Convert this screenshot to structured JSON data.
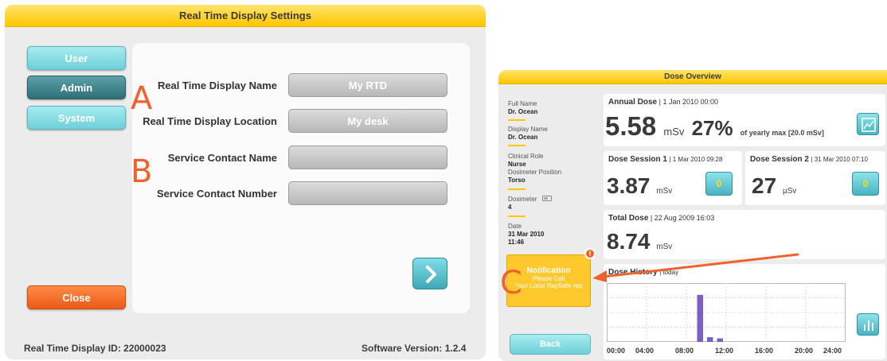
{
  "settings": {
    "title": "Real Time Display Settings",
    "sidebar": {
      "user": "User",
      "admin": "Admin",
      "system": "System",
      "close": "Close"
    },
    "fields": [
      {
        "label": "Real Time Display Name",
        "value": "My RTD"
      },
      {
        "label": "Real Time Display Location",
        "value": "My desk"
      },
      {
        "label": "Service Contact Name",
        "value": ""
      },
      {
        "label": "Service Contact Number",
        "value": ""
      }
    ],
    "footer": {
      "id": "Real Time Display ID: 22000023",
      "version": "Software Version: 1.2.4"
    }
  },
  "annotations": {
    "a": "A",
    "b": "B",
    "c": "C",
    "color": "#f0622d"
  },
  "dose": {
    "title": "Dose Overview",
    "info": {
      "full_name_label": "Full Name",
      "full_name": "Dr. Ocean",
      "display_name_label": "Display Name",
      "display_name": "Dr. Ocean",
      "clinical_role_label": "Clinical Role",
      "clinical_role": "Nurse",
      "position_label": "Dosimeter Position",
      "position": "Torso",
      "dosimeter_label": "Dosimeter",
      "dosimeter": "4",
      "date_label": "Date",
      "date": "31 Mar 2010",
      "time": "11:46"
    },
    "annual": {
      "title": "Annual Dose",
      "date": "| 1 Jan 2010 00:00",
      "value": "5.58",
      "unit": "mSv",
      "percent": "27%",
      "of_max": "of yearly max [20.0 mSv]"
    },
    "session1": {
      "title": "Dose Session 1",
      "date": "| 1 Mar 2010 09:28",
      "value": "3.87",
      "unit": "mSv",
      "button": "0"
    },
    "session2": {
      "title": "Dose Session 2",
      "date": "| 31 Mar 2010 07:10",
      "value": "27",
      "unit": "µSv",
      "button": "0"
    },
    "total": {
      "title": "Total Dose",
      "date": "| 22 Aug 2009 16:03",
      "value": "8.74",
      "unit": "mSv"
    },
    "notification": {
      "title": "Notification",
      "line1": "Please Call",
      "line2": "Your Local RaySafe rep",
      "badge": "!"
    },
    "history": {
      "title": "Dose History",
      "period": "| today"
    },
    "back": "Back",
    "chart_data": {
      "type": "bar",
      "x_ticks": [
        "00:00",
        "04:00",
        "08:00",
        "12:00",
        "16:00",
        "20:00",
        "24:00"
      ],
      "bars": [
        {
          "hour": 9,
          "value": 0.8
        },
        {
          "hour": 10,
          "value": 0.08
        },
        {
          "hour": 11,
          "value": 0.06
        }
      ],
      "xlim": [
        0,
        24
      ],
      "ylim": [
        0,
        1
      ],
      "bar_color": "#7b5fc9"
    }
  }
}
